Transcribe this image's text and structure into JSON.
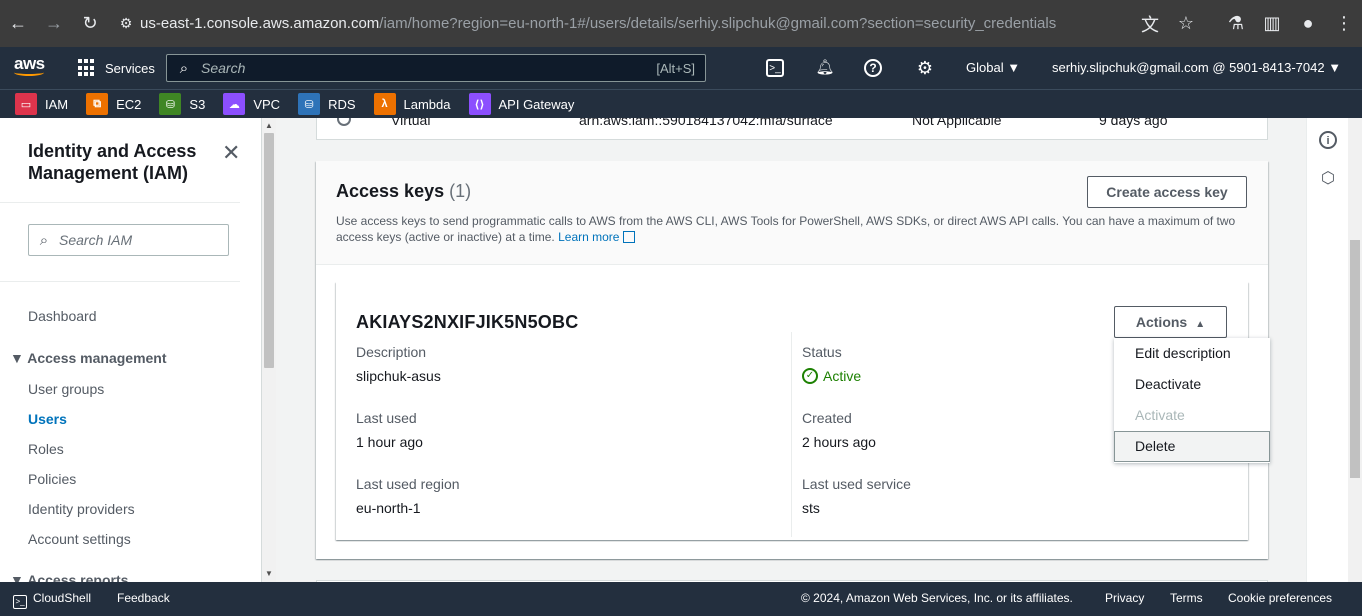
{
  "browser": {
    "url_host": "us-east-1.console.aws.amazon.com",
    "url_rest": "/iam/home?region=eu-north-1#/users/details/serhiy.slipchuk@gmail.com?section=security_credentials"
  },
  "awsnav": {
    "services_label": "Services",
    "search_placeholder": "Search",
    "search_hint": "[Alt+S]",
    "region": "Global",
    "account": "serhiy.slipchuk@gmail.com @ 5901-8413-7042"
  },
  "favorites": [
    {
      "label": "IAM",
      "color": "#dd344c"
    },
    {
      "label": "EC2",
      "color": "#ed7100"
    },
    {
      "label": "S3",
      "color": "#3f8624"
    },
    {
      "label": "VPC",
      "color": "#8c4fff"
    },
    {
      "label": "RDS",
      "color": "#2e73b8"
    },
    {
      "label": "Lambda",
      "color": "#ed7100"
    },
    {
      "label": "API Gateway",
      "color": "#8c4fff"
    }
  ],
  "sidenav": {
    "title": "Identity and Access Management (IAM)",
    "search_placeholder": "Search IAM",
    "dashboard": "Dashboard",
    "group_access_management": "Access management",
    "items": [
      "User groups",
      "Users",
      "Roles",
      "Policies",
      "Identity providers",
      "Account settings"
    ],
    "group_access_reports": "Access reports"
  },
  "prev_row": {
    "type": "Virtual",
    "arn": "arn:aws:iam::590184137042:mfa/surface",
    "status": "Not Applicable",
    "created": "9 days ago"
  },
  "access_keys": {
    "title": "Access keys",
    "count": "(1)",
    "description": "Use access keys to send programmatic calls to AWS from the AWS CLI, AWS Tools for PowerShell, AWS SDKs, or direct AWS API calls. You can have a maximum of two access keys (active or inactive) at a time.",
    "learn_more": "Learn more",
    "create_button": "Create access key",
    "key": {
      "id": "AKIAYS2NXIFJIK5N5OBC",
      "actions_label": "Actions",
      "description_label": "Description",
      "description_value": "slipchuk-asus",
      "status_label": "Status",
      "status_value": "Active",
      "last_used_label": "Last used",
      "last_used_value": "1 hour ago",
      "created_label": "Created",
      "created_value": "2 hours ago",
      "last_used_region_label": "Last used region",
      "last_used_region_value": "eu-north-1",
      "last_used_service_label": "Last used service",
      "last_used_service_value": "sts"
    }
  },
  "actions_menu": {
    "items": [
      "Edit description",
      "Deactivate",
      "Activate",
      "Delete"
    ]
  },
  "footer": {
    "cloudshell": "CloudShell",
    "feedback": "Feedback",
    "copyright": "© 2024, Amazon Web Services, Inc. or its affiliates.",
    "privacy": "Privacy",
    "terms": "Terms",
    "cookies": "Cookie preferences"
  }
}
